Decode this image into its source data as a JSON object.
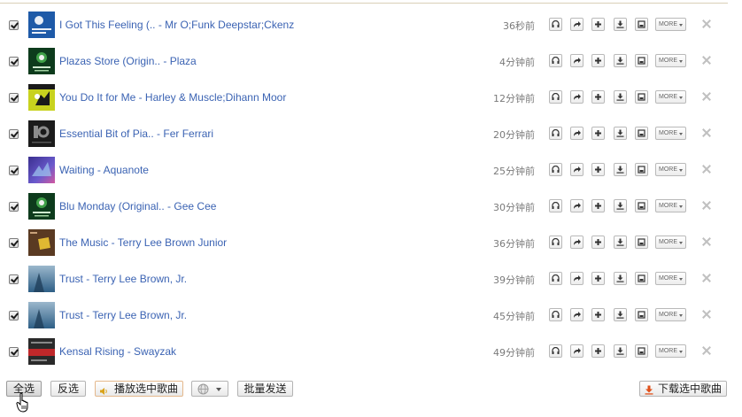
{
  "songs": [
    {
      "title": "I Got This Feeling (.. - Mr O;Funk Deepstar;Ckenz",
      "time": "36秒前",
      "checked": true,
      "cover_colors": [
        "#1e5aa8",
        "#e8eef7"
      ]
    },
    {
      "title": "Plazas Store (Origin.. - Plaza",
      "time": "4分钟前",
      "checked": true,
      "cover_colors": [
        "#0d3b1c",
        "#3fa048"
      ]
    },
    {
      "title": "You Do It for Me - Harley & Muscle;Dihann Moor",
      "time": "12分钟前",
      "checked": true,
      "cover_colors": [
        "#c8d21e",
        "#1a1a1a"
      ]
    },
    {
      "title": "Essential Bit of Pia.. - Fer Ferrari",
      "time": "20分钟前",
      "checked": true,
      "cover_colors": [
        "#1b1b1b",
        "#8c8c8c"
      ]
    },
    {
      "title": "Waiting - Aquanote",
      "time": "25分钟前",
      "checked": true,
      "cover_colors": [
        "#6a5acd",
        "#d25aa0"
      ]
    },
    {
      "title": "Blu Monday (Original.. - Gee Cee",
      "time": "30分钟前",
      "checked": true,
      "cover_colors": [
        "#0d3b1c",
        "#3fa048"
      ]
    },
    {
      "title": "The Music - Terry Lee Brown Junior",
      "time": "36分钟前",
      "checked": true,
      "cover_colors": [
        "#5a3a22",
        "#e0b832"
      ]
    },
    {
      "title": "Trust - Terry Lee Brown, Jr.",
      "time": "39分钟前",
      "checked": true,
      "cover_colors": [
        "#2e5f86",
        "#9bb7cc"
      ]
    },
    {
      "title": "Trust - Terry Lee Brown, Jr.",
      "time": "45分钟前",
      "checked": true,
      "cover_colors": [
        "#2e5f86",
        "#9bb7cc"
      ]
    },
    {
      "title": "Kensal Rising - Swayzak",
      "time": "49分钟前",
      "checked": true,
      "cover_colors": [
        "#2a2a2a",
        "#c0282a"
      ]
    }
  ],
  "row_actions": {
    "more_label": "MORE",
    "icons": [
      "headphones-icon",
      "share-arrow-icon",
      "plus-icon",
      "download-icon",
      "save-icon"
    ]
  },
  "toolbar": {
    "select_all": "全选",
    "invert": "反选",
    "play_selected": "播放选中歌曲",
    "batch_send": "批量发送",
    "download_selected": "下载选中歌曲"
  },
  "colors": {
    "link": "#3b63b3",
    "time": "#7a7a7a",
    "play_border": "#e4b88c",
    "download_icon": "#e0501a"
  }
}
